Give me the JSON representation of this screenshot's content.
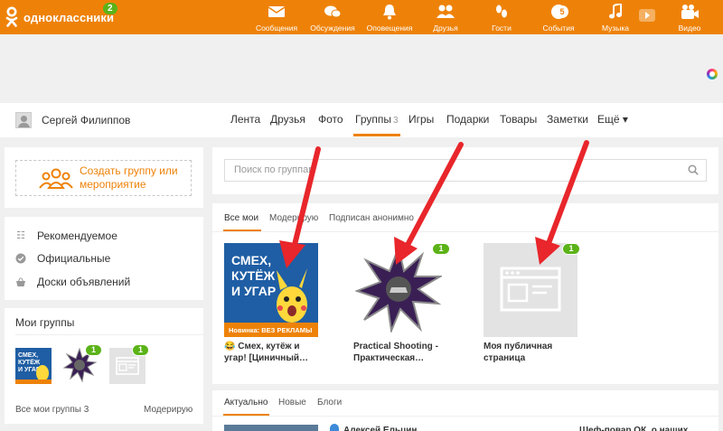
{
  "header": {
    "logo_text": "одноклассники",
    "logo_badge": "2",
    "nav": [
      {
        "label": "Сообщения",
        "icon": "envelope-icon"
      },
      {
        "label": "Обсуждения",
        "icon": "chat-bubbles-icon"
      },
      {
        "label": "Оповещения",
        "icon": "bell-icon"
      },
      {
        "label": "Друзья",
        "icon": "friends-icon"
      },
      {
        "label": "Гости",
        "icon": "footprints-icon"
      },
      {
        "label": "События",
        "icon": "events-icon",
        "badge": "5"
      },
      {
        "label": "Музыка",
        "icon": "music-note-icon"
      },
      {
        "label": "Видео",
        "icon": "video-camera-icon"
      }
    ]
  },
  "profile": {
    "name": "Сергей Филиппов",
    "tabs": [
      {
        "label": "Лента"
      },
      {
        "label": "Друзья"
      },
      {
        "label": "Фото"
      },
      {
        "label": "Группы",
        "count": "3"
      },
      {
        "label": "Игры"
      },
      {
        "label": "Подарки"
      },
      {
        "label": "Товары"
      },
      {
        "label": "Заметки"
      },
      {
        "label": "Ещё ▾"
      }
    ]
  },
  "sidebar": {
    "create_button": "Создать группу или мероприятие",
    "links": [
      {
        "label": "Рекомендуемое",
        "icon": "list-icon"
      },
      {
        "label": "Официальные",
        "icon": "check-circle-icon"
      },
      {
        "label": "Доски объявлений",
        "icon": "basket-icon"
      }
    ],
    "my_groups_title": "Мои группы",
    "my_groups_badges": [
      "1",
      "1"
    ],
    "all_groups_link": "Все мои группы 3",
    "moderate_link": "Модерирую"
  },
  "main": {
    "search_placeholder": "Поиск по группам",
    "tabs": [
      {
        "label": "Все мои"
      },
      {
        "label": "Модерирую"
      },
      {
        "label": "Подписан анонимно"
      }
    ],
    "groups": [
      {
        "name": "😂 Смех, кутёж и угар! [Циничный…",
        "poster_text": "СМЕХ, КУТЁЖ И УГАР",
        "poster_strip": "Новинка: ВЕЗ РЕКЛАМЫ"
      },
      {
        "name": "Practical Shooting - Практическая…",
        "badge": "1"
      },
      {
        "name": "Моя публичная страница",
        "badge": "1"
      }
    ],
    "feed_tabs": [
      {
        "label": "Актуально"
      },
      {
        "label": "Новые"
      },
      {
        "label": "Блоги"
      }
    ],
    "feed_preview": {
      "author": "Алексей Ельцин",
      "side_text": "Шеф-повар ОК, о наших"
    }
  },
  "colors": {
    "brand": "#ee8208",
    "badge_green": "#5bb318",
    "arrow_red": "#e8262b"
  }
}
